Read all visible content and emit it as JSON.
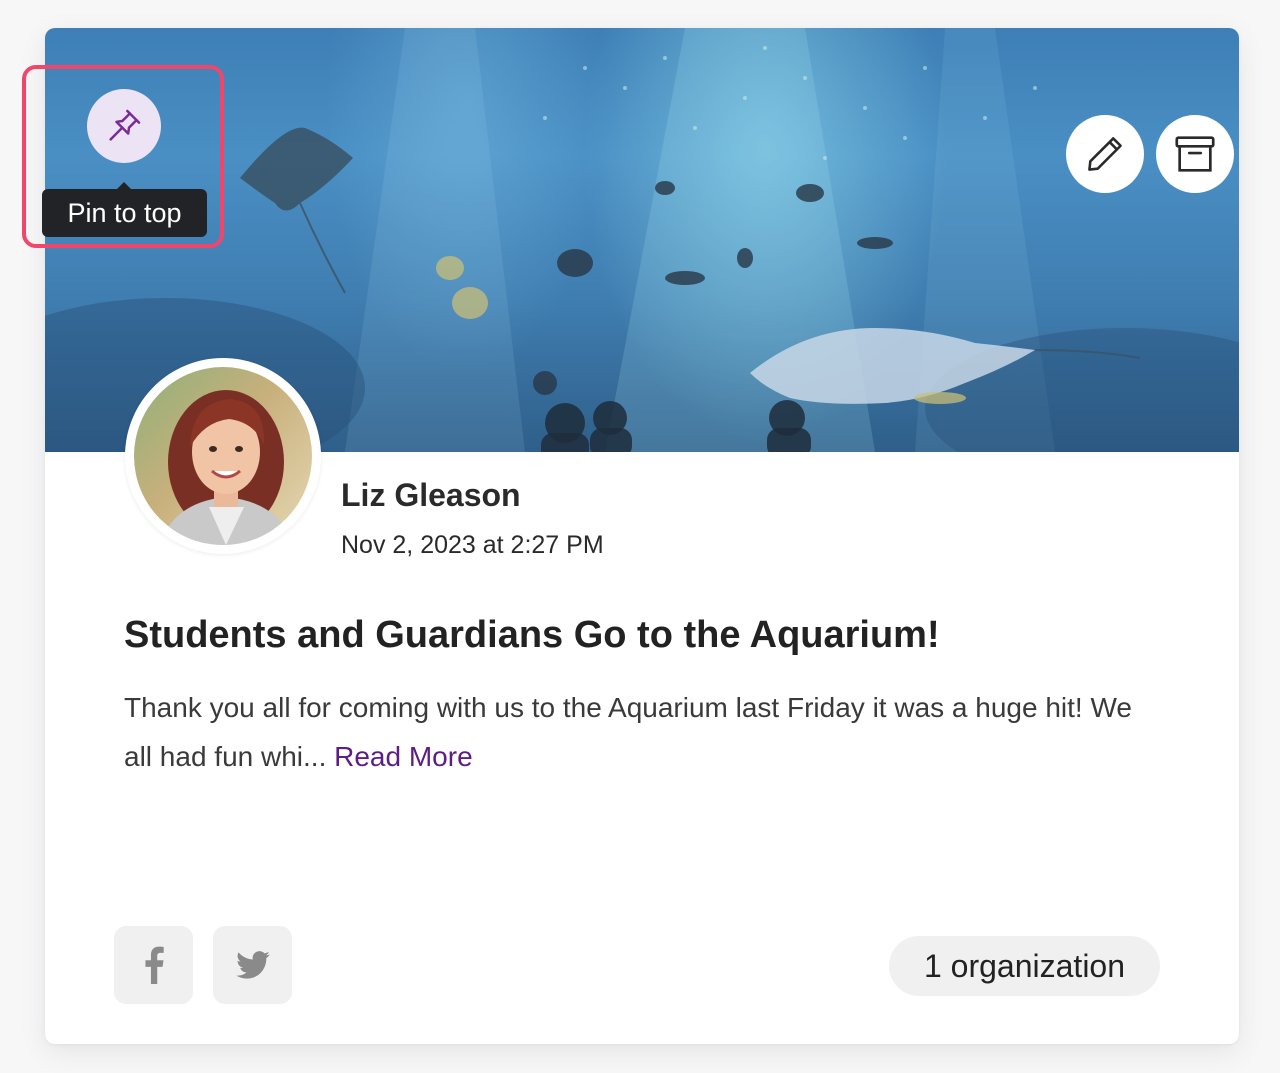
{
  "post": {
    "author_name": "Liz Gleason",
    "date": "Nov 2, 2023 at 2:27 PM",
    "title": "Students and Guardians Go to the Aquarium!",
    "excerpt": "Thank you all for coming with us to the Aquarium last Friday it was a huge hit! We all had fun whi...",
    "read_more_label": "Read More"
  },
  "actions": {
    "pin_tooltip": "Pin to top",
    "pin_icon": "pushpin-icon",
    "edit_icon": "pencil-icon",
    "archive_icon": "archive-box-icon"
  },
  "share": {
    "facebook_icon": "facebook-icon",
    "twitter_icon": "twitter-icon"
  },
  "audience": {
    "badge_label": "1 organization"
  },
  "colors": {
    "accent": "#5c1e84",
    "highlight": "#f0466c",
    "pin_bg": "#ece4f4",
    "tooltip_bg": "#222326"
  }
}
